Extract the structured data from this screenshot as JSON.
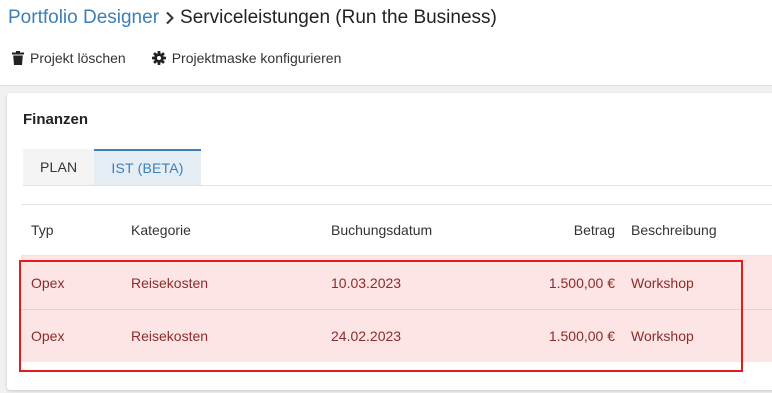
{
  "breadcrumb": {
    "parent": "Portfolio Designer",
    "current": "Serviceleistungen (Run the Business)"
  },
  "toolbar": {
    "delete_label": "Projekt löschen",
    "configure_label": "Projektmaske konfigurieren"
  },
  "section": {
    "title": "Finanzen",
    "tabs": [
      {
        "label": "PLAN",
        "active": false
      },
      {
        "label": "IST (BETA)",
        "active": true
      }
    ]
  },
  "table": {
    "headers": {
      "typ": "Typ",
      "kategorie": "Kategorie",
      "datum": "Buchungsdatum",
      "betrag": "Betrag",
      "beschreibung": "Beschreibung"
    },
    "rows": [
      {
        "typ": "Opex",
        "kategorie": "Reisekosten",
        "datum": "10.03.2023",
        "betrag": "1.500,00 €",
        "beschreibung": "Workshop"
      },
      {
        "typ": "Opex",
        "kategorie": "Reisekosten",
        "datum": "24.02.2023",
        "betrag": "1.500,00 €",
        "beschreibung": "Workshop"
      }
    ]
  },
  "colors": {
    "accent": "#3d7fb6",
    "row_highlight": "#fde5e5",
    "highlight_border": "#e21c1c"
  },
  "icons": {
    "delete": "trash-icon",
    "configure": "gear-icon",
    "separator": "chevron-right-icon"
  }
}
